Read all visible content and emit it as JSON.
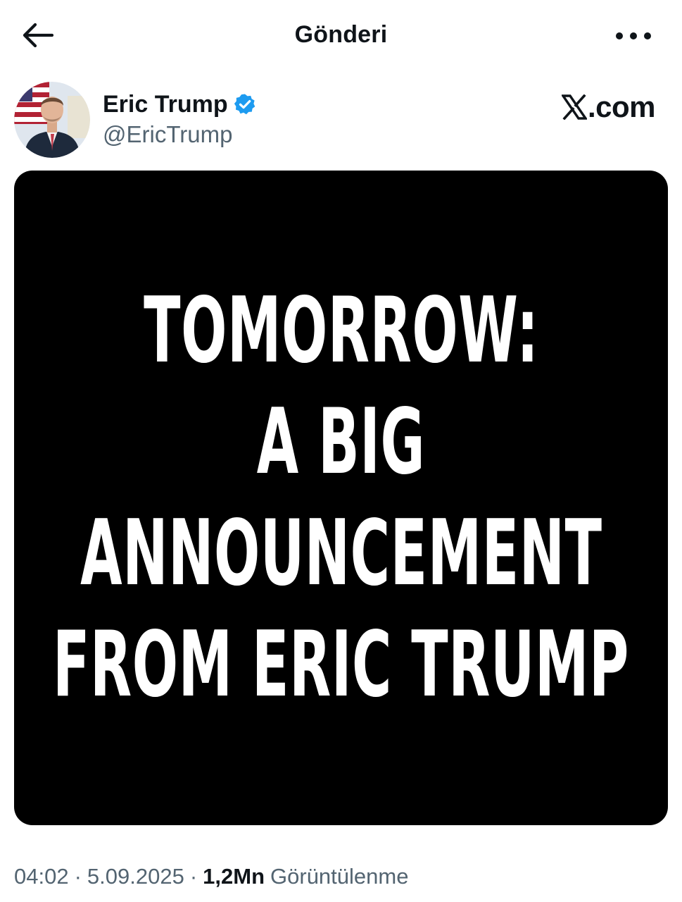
{
  "header": {
    "title": "Gönderi",
    "back_icon": "arrow-left-icon",
    "more_icon": "more-horizontal-icon"
  },
  "author": {
    "name": "Eric Trump",
    "handle": "@EricTrump",
    "verified": true,
    "verified_color": "#1d9bf0"
  },
  "watermark": {
    "logo_icon": "x-logo-icon",
    "text": ".com"
  },
  "post": {
    "image_lines": [
      "TOMORROW:",
      "A BIG",
      "ANNOUNCEMENT",
      "FROM ERIC TRUMP"
    ]
  },
  "meta": {
    "time": "04:02",
    "date": "5.09.2025",
    "views_count": "1,2Mn",
    "views_label": "Görüntülenme"
  },
  "colors": {
    "text_primary": "#0f1419",
    "text_secondary": "#536471",
    "media_bg": "#000000"
  }
}
